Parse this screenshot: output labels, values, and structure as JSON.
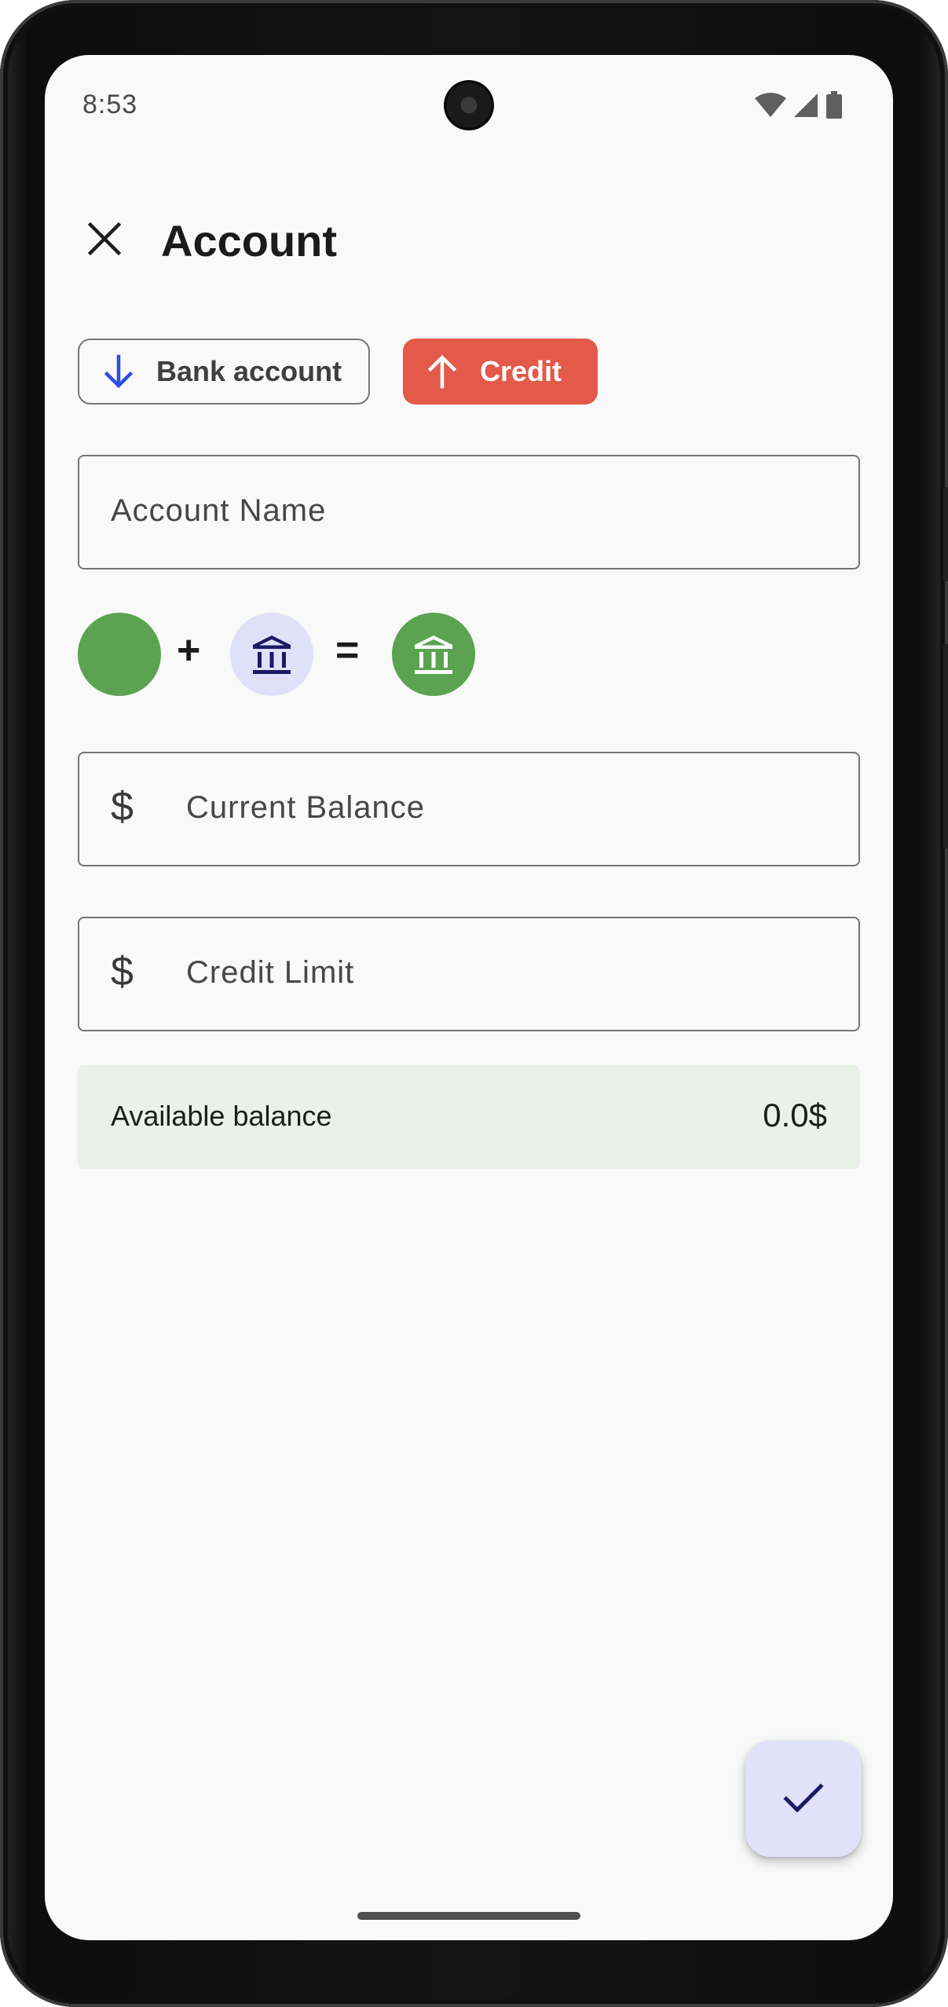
{
  "status_bar": {
    "time": "8:53",
    "icons": [
      "wifi-icon",
      "signal-icon",
      "battery-icon"
    ]
  },
  "header": {
    "title": "Account",
    "close_icon": "close-icon"
  },
  "account_type": {
    "options": [
      {
        "label": "Bank account",
        "icon": "arrow-down-icon",
        "selected": false
      },
      {
        "label": "Credit",
        "icon": "arrow-up-icon",
        "selected": true
      }
    ]
  },
  "form": {
    "account_name": {
      "placeholder": "Account Name",
      "value": ""
    },
    "current_balance": {
      "prefix": "$",
      "placeholder": "Current Balance",
      "value": ""
    },
    "credit_limit": {
      "prefix": "$",
      "placeholder": "Credit Limit",
      "value": ""
    }
  },
  "appearance": {
    "color": "#5ba351",
    "icon": "bank-icon",
    "plus": "+",
    "equals": "="
  },
  "available_balance": {
    "label": "Available balance",
    "value": "0.0$"
  },
  "fab": {
    "icon": "check-icon"
  },
  "colors": {
    "credit_accent": "#e35a4a",
    "bank_arrow": "#2f4de0",
    "icon_bg": "#e1e0f9",
    "selected_color": "#5ba351",
    "available_bg": "#e9f1e8",
    "fab_bg": "#e1e1fa"
  }
}
